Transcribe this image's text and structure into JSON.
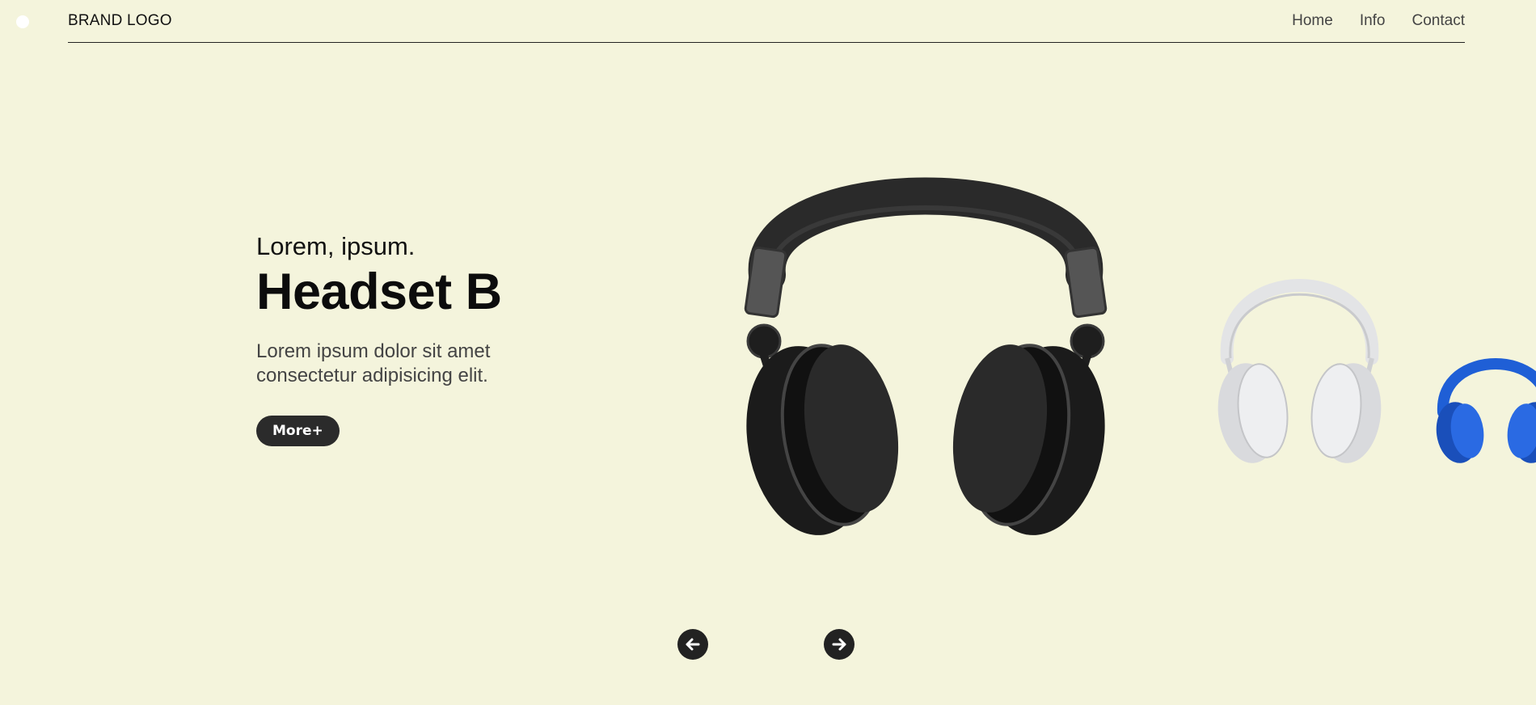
{
  "brand": {
    "logo_text": "BRAND LOGO"
  },
  "nav": {
    "items": [
      {
        "label": "Home"
      },
      {
        "label": "Info"
      },
      {
        "label": "Contact"
      }
    ]
  },
  "hero": {
    "eyebrow": "Lorem, ipsum.",
    "title": "Headset B",
    "description_line1": "Lorem ipsum dolor sit amet",
    "description_line2": "consectetur adipisicing elit.",
    "cta_label": "More+"
  },
  "carousel": {
    "products": [
      {
        "name": "black-headphones",
        "color": "#1e1e1e"
      },
      {
        "name": "white-headphones",
        "color": "#e3e4e6"
      },
      {
        "name": "blue-headphones",
        "color": "#1f5fd6"
      }
    ],
    "controls": {
      "prev_icon": "arrow-left-icon",
      "next_icon": "arrow-right-icon"
    }
  },
  "colors": {
    "background": "#f4f4dc",
    "button": "#2b2b2b",
    "text": "#111111"
  }
}
